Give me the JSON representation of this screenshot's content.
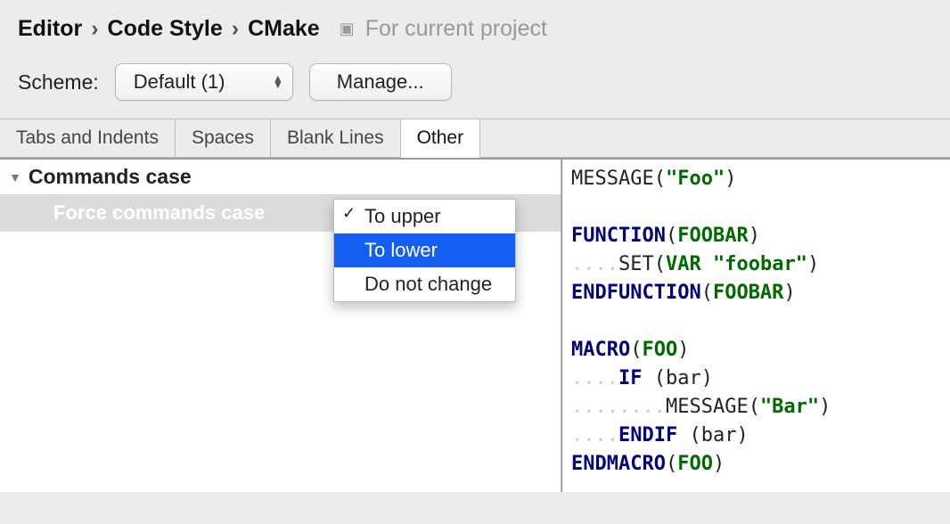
{
  "breadcrumb": {
    "a": "Editor",
    "b": "Code Style",
    "c": "CMake",
    "sep": "›"
  },
  "scope": "For current project",
  "scheme": {
    "label": "Scheme:",
    "value": "Default (1)",
    "manage": "Manage..."
  },
  "tabs": {
    "t1": "Tabs and Indents",
    "t2": "Spaces",
    "t3": "Blank Lines",
    "t4": "Other"
  },
  "section": {
    "title": "Commands case",
    "option_label": "Force commands case"
  },
  "dropdown": {
    "o1": "To upper",
    "o2": "To lower",
    "o3": "Do not change"
  },
  "code": {
    "l1a": "MESSAGE",
    "l1b": "(",
    "l1c": "\"Foo\"",
    "l1d": ")",
    "blank": " ",
    "l3a": "FUNCTION",
    "l3b": "(",
    "l3c": "FOOBAR",
    "l3d": ")",
    "dots4": "....",
    "l4a": "SET",
    "l4b": "(",
    "l4c": "VAR",
    "sp": " ",
    "l4d": "\"foobar\"",
    "l4e": ")",
    "l5a": "ENDFUNCTION",
    "l5b": "(",
    "l5c": "FOOBAR",
    "l5d": ")",
    "l7a": "MACRO",
    "l7b": "(",
    "l7c": "FOO",
    "l7d": ")",
    "l8a": "IF",
    "l8b": " (",
    "l8c": "bar",
    "l8d": ")",
    "dots8": "........",
    "l9a": "MESSAGE",
    "l9b": "(",
    "l9c": "\"Bar\"",
    "l9d": ")",
    "l10a": "ENDIF",
    "l10b": " (",
    "l10c": "bar",
    "l10d": ")",
    "l11a": "ENDMACRO",
    "l11b": "(",
    "l11c": "FOO",
    "l11d": ")"
  }
}
